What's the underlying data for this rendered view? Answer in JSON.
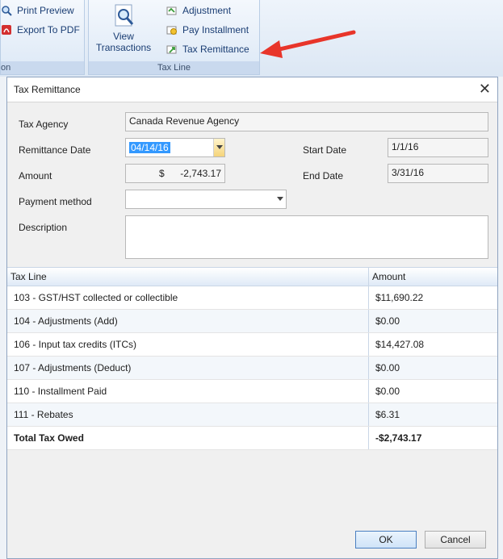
{
  "ribbon": {
    "print_preview": "Print Preview",
    "export_pdf": "Export To PDF",
    "left_caption": "on",
    "view_transactions_line1": "View",
    "view_transactions_line2": "Transactions",
    "adjustment": "Adjustment",
    "pay_installment": "Pay Installment",
    "tax_remittance": "Tax Remittance",
    "group_caption": "Tax Line"
  },
  "dialog": {
    "title": "Tax Remittance",
    "close_glyph": "✕",
    "labels": {
      "tax_agency": "Tax Agency",
      "remittance_date": "Remittance Date",
      "amount": "Amount",
      "payment_method": "Payment method",
      "description": "Description",
      "start_date": "Start Date",
      "end_date": "End Date"
    },
    "values": {
      "tax_agency": "Canada Revenue Agency",
      "remittance_date": "04/14/16",
      "amount_currency": "$",
      "amount": "-2,743.17",
      "payment_method": "",
      "description": "",
      "start_date": "1/1/16",
      "end_date": "3/31/16"
    },
    "grid": {
      "headers": [
        "Tax Line",
        "Amount"
      ],
      "rows": [
        {
          "line": "103 - GST/HST collected or collectible",
          "amount": "$11,690.22"
        },
        {
          "line": "104 - Adjustments (Add)",
          "amount": "$0.00"
        },
        {
          "line": "106 - Input tax credits (ITCs)",
          "amount": "$14,427.08"
        },
        {
          "line": "107 - Adjustments (Deduct)",
          "amount": "$0.00"
        },
        {
          "line": "110 - Installment Paid",
          "amount": "$0.00"
        },
        {
          "line": "111 - Rebates",
          "amount": "$6.31"
        }
      ],
      "total_label": "Total Tax Owed",
      "total_amount": "-$2,743.17"
    },
    "ok": "OK",
    "cancel": "Cancel"
  },
  "colors": {
    "accent_arrow": "#e8352a",
    "selection": "#3399ff",
    "ribbon_text": "#1a3d73"
  }
}
